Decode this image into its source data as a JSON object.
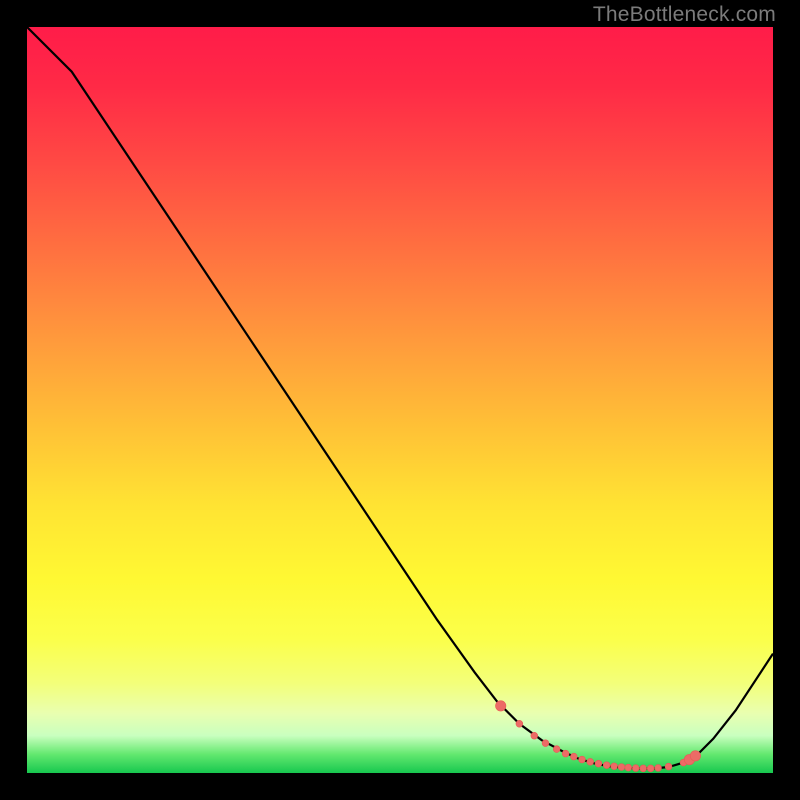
{
  "watermark": "TheBottleneck.com",
  "colors": {
    "frame": "#000000",
    "curve_stroke": "#000000",
    "marker_fill": "#ec6b66",
    "marker_stroke": "#e95a55"
  },
  "chart_data": {
    "type": "line",
    "title": "",
    "xlabel": "",
    "ylabel": "",
    "xlim": [
      0,
      100
    ],
    "ylim": [
      0,
      100
    ],
    "grid": false,
    "legend": false,
    "x": [
      0,
      6,
      10,
      15,
      20,
      25,
      30,
      35,
      40,
      45,
      50,
      55,
      60,
      63,
      66,
      69,
      72,
      74,
      76,
      78,
      80,
      82,
      84,
      86,
      88,
      90,
      92,
      95,
      100
    ],
    "y": [
      100,
      94,
      88,
      80.5,
      73,
      65.5,
      58,
      50.5,
      43,
      35.5,
      28,
      20.5,
      13.5,
      9.6,
      6.6,
      4.4,
      2.8,
      1.9,
      1.3,
      0.9,
      0.7,
      0.6,
      0.6,
      0.8,
      1.4,
      2.6,
      4.6,
      8.4,
      16
    ],
    "markers": {
      "x": [
        63.5,
        66,
        68,
        69.5,
        71,
        72.2,
        73.3,
        74.4,
        75.5,
        76.6,
        77.7,
        78.7,
        79.7,
        80.6,
        81.6,
        82.6,
        83.6,
        84.6,
        86,
        88,
        88.8,
        89.6
      ],
      "y": [
        9.0,
        6.6,
        5.0,
        4.0,
        3.2,
        2.6,
        2.2,
        1.8,
        1.5,
        1.25,
        1.05,
        0.9,
        0.8,
        0.72,
        0.66,
        0.62,
        0.62,
        0.68,
        0.86,
        1.4,
        1.8,
        2.3
      ]
    }
  }
}
